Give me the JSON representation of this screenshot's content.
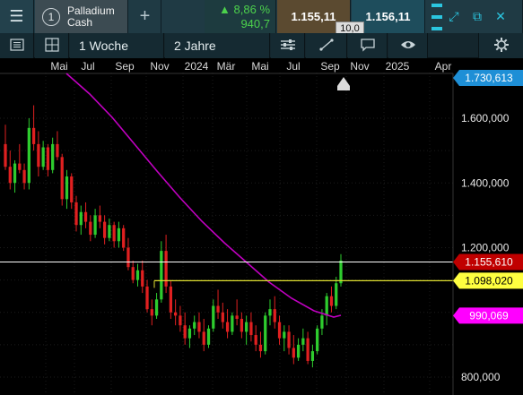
{
  "header": {
    "menu_icon": "hamburger-menu-icon",
    "instrument_number": "1",
    "instrument_name_line1": "Palladium",
    "instrument_name_line2": "Cash",
    "add_icon": "plus-icon",
    "change_percent": "▲ 8,86 %",
    "change_absolute": "940,7",
    "bid": "1.155,11",
    "ask": "1.156,11",
    "spread": "10,0",
    "window_icons": [
      "expand-icon",
      "popout-icon",
      "close-icon"
    ]
  },
  "toolbar": {
    "list_icon": "list-icon",
    "layout_icon": "grid-layout-icon",
    "interval": "1 Woche",
    "range": "2 Jahre",
    "settings_icon": "sliders-icon",
    "draw_icon": "draw-tools-icon",
    "comment_icon": "speech-bubble-icon",
    "view_icon": "eye-icon",
    "gear_icon": "gear-icon"
  },
  "chart_data": {
    "type": "candlestick",
    "x_tick_labels": [
      "Mai",
      "Jul",
      "Sep",
      "Nov",
      "2024",
      "Mär",
      "Mai",
      "Jul",
      "Sep",
      "Nov",
      "2025",
      "Apr"
    ],
    "y_tick_labels": [
      "1.600,000",
      "1.400,000",
      "1.200,000",
      "800,000"
    ],
    "y_ticks": [
      1600,
      1400,
      1200,
      800
    ],
    "ylim": [
      720,
      1790
    ],
    "price_markers": {
      "top_marker": "1.730,613",
      "current_price": "1.155,610",
      "horizontal_level": "1.098,020",
      "moving_average": "990,069"
    },
    "price_levels": [
      1730.613,
      1155.61,
      1098.02,
      990.069
    ],
    "colors": {
      "up": "#2ecc2e",
      "down": "#e02020",
      "moving_average": "#c000c0",
      "level_line": "#e0e030",
      "current_line": "#ffffff",
      "top_marker": "#1e8fd6",
      "current_tag": "#c00000",
      "level_tag": "#ffff40",
      "ma_tag": "#ff00ff"
    }
  }
}
